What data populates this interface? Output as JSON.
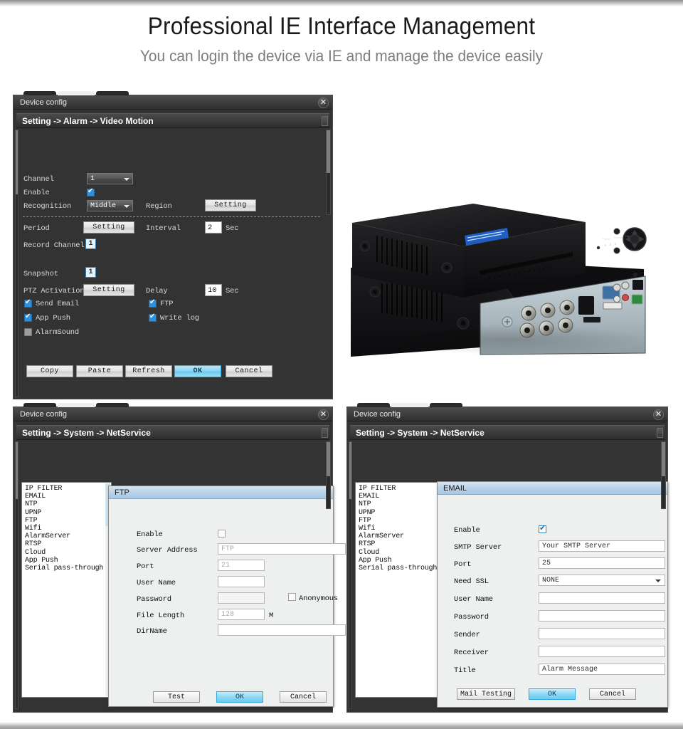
{
  "header": {
    "title": "Professional IE Interface Management",
    "subtitle": "You can login the device via IE and manage the device easily"
  },
  "colors": {
    "dialog_dark_bg": "#333333",
    "titlebar_dark": "#3e3e3e",
    "panel_light_bg": "#eef0f0",
    "panel_header_blue": "#b9d3ea",
    "primary_button_blue": "#8ad6f4",
    "checkbox_checked_blue": "#2f8fd8",
    "accent_box_blue": "#e8f4fc",
    "heading_text": "#1a1a1a",
    "subheading_text": "#7d7d7d"
  },
  "dialog_motion": {
    "window_title": "Device config",
    "close_icon": "close-icon",
    "breadcrumb": "Setting -> Alarm -> Video Motion",
    "fields": {
      "channel_label": "Channel",
      "channel_value": "1",
      "enable_label": "Enable",
      "enable_checked": true,
      "recognition_label": "Recognition",
      "recognition_value": "Middle",
      "region_label": "Region",
      "region_button": "Setting",
      "period_label": "Period",
      "period_button": "Setting",
      "interval_label": "Interval",
      "interval_value": "2",
      "interval_unit": "Sec",
      "record_channel_label": "Record Channel",
      "record_channel_value": "1",
      "snapshot_label": "Snapshot",
      "snapshot_value": "1",
      "ptz_label": "PTZ Activation",
      "ptz_button": "Setting",
      "delay_label": "Delay",
      "delay_value": "10",
      "delay_unit": "Sec",
      "send_email_label": "Send Email",
      "send_email_checked": true,
      "ftp_label": "FTP",
      "ftp_checked": true,
      "app_push_label": "App Push",
      "app_push_checked": true,
      "write_log_label": "Write log",
      "write_log_checked": true,
      "alarm_sound_label": "AlarmSound",
      "alarm_sound_checked": false
    },
    "buttons": {
      "copy": "Copy",
      "paste": "Paste",
      "refresh": "Refresh",
      "ok": "OK",
      "cancel": "Cancel"
    }
  },
  "netservice_list": [
    "IP FILTER",
    "EMAIL",
    "NTP",
    "UPNP",
    "FTP",
    "Wifi",
    "AlarmServer",
    "RTSP",
    "Cloud",
    "App Push",
    "Serial pass-through"
  ],
  "dialog_ftp": {
    "window_title": "Device config",
    "close_icon": "close-icon",
    "breadcrumb": "Setting -> System -> NetService",
    "panel_title": "FTP",
    "fields": {
      "enable_label": "Enable",
      "enable_checked": false,
      "server_address_label": "Server Address",
      "server_address_value": "FTP",
      "port_label": "Port",
      "port_value": "21",
      "user_name_label": "User Name",
      "user_name_value": "",
      "password_label": "Password",
      "password_value": "",
      "anonymous_label": "Anonymous",
      "anonymous_checked": false,
      "file_length_label": "File Length",
      "file_length_value": "128",
      "file_length_unit": "M",
      "dirname_label": "DirName",
      "dirname_value": ""
    },
    "buttons": {
      "test": "Test",
      "ok": "OK",
      "cancel": "Cancel"
    }
  },
  "dialog_email": {
    "window_title": "Device config",
    "close_icon": "close-icon",
    "breadcrumb": "Setting -> System -> NetService",
    "panel_title": "EMAIL",
    "fields": {
      "enable_label": "Enable",
      "enable_checked": true,
      "smtp_server_label": "SMTP Server",
      "smtp_server_value": "Your SMTP Server",
      "port_label": "Port",
      "port_value": "25",
      "need_ssl_label": "Need SSL",
      "need_ssl_value": "NONE",
      "user_name_label": "User Name",
      "user_name_value": "",
      "password_label": "Password",
      "password_value": "",
      "sender_label": "Sender",
      "sender_value": "",
      "receiver_label": "Receiver",
      "receiver_value": "",
      "title_label": "Title",
      "title_value": "Alarm Message"
    },
    "buttons": {
      "mail_testing": "Mail Testing",
      "ok": "OK",
      "cancel": "Cancel"
    }
  },
  "product_photo": {
    "alt": "black DVR recorder units stacked, front and rear view"
  }
}
